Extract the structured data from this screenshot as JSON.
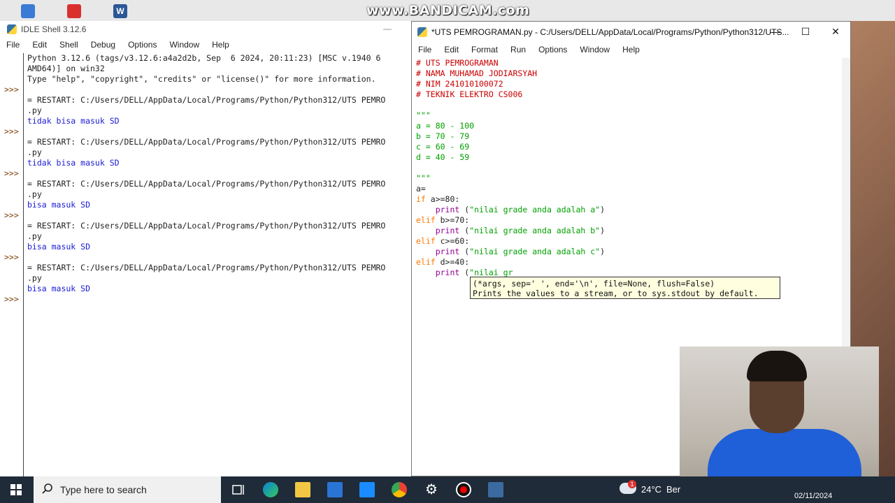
{
  "watermark": "www.BANDICAM.com",
  "shell": {
    "title": "IDLE Shell 3.12.6",
    "menu": [
      "File",
      "Edit",
      "Shell",
      "Debug",
      "Options",
      "Window",
      "Help"
    ],
    "lines": [
      {
        "t": "Python 3.12.6 (tags/v3.12.6:a4a2d2b, Sep  6 2024, 20:11:23) [MSC v.1940 6",
        "c": "out"
      },
      {
        "t": "AMD64)] on win32",
        "c": "out"
      },
      {
        "t": "Type \"help\", \"copyright\", \"credits\" or \"license()\" for more information.",
        "c": "out"
      },
      {
        "t": "",
        "c": "out"
      },
      {
        "t": "= RESTART: C:/Users/DELL/AppData/Local/Programs/Python/Python312/UTS PEMRO",
        "c": "out"
      },
      {
        "t": ".py",
        "c": "out"
      },
      {
        "t": "tidak bisa masuk SD",
        "c": "blue"
      },
      {
        "t": "",
        "c": "out"
      },
      {
        "t": "= RESTART: C:/Users/DELL/AppData/Local/Programs/Python/Python312/UTS PEMRO",
        "c": "out"
      },
      {
        "t": ".py",
        "c": "out"
      },
      {
        "t": "tidak bisa masuk SD",
        "c": "blue"
      },
      {
        "t": "",
        "c": "out"
      },
      {
        "t": "= RESTART: C:/Users/DELL/AppData/Local/Programs/Python/Python312/UTS PEMRO",
        "c": "out"
      },
      {
        "t": ".py",
        "c": "out"
      },
      {
        "t": "bisa masuk SD",
        "c": "blue"
      },
      {
        "t": "",
        "c": "out"
      },
      {
        "t": "= RESTART: C:/Users/DELL/AppData/Local/Programs/Python/Python312/UTS PEMRO",
        "c": "out"
      },
      {
        "t": ".py",
        "c": "out"
      },
      {
        "t": "bisa masuk SD",
        "c": "blue"
      },
      {
        "t": "",
        "c": "out"
      },
      {
        "t": "= RESTART: C:/Users/DELL/AppData/Local/Programs/Python/Python312/UTS PEMRO",
        "c": "out"
      },
      {
        "t": ".py",
        "c": "out"
      },
      {
        "t": "bisa masuk SD",
        "c": "blue"
      }
    ],
    "prompt": ">>>"
  },
  "editor": {
    "title": "*UTS PEMROGRAMAN.py - C:/Users/DELL/AppData/Local/Programs/Python/Python312/UTS...",
    "menu": [
      "File",
      "Edit",
      "Format",
      "Run",
      "Options",
      "Window",
      "Help"
    ],
    "lines": [
      [
        {
          "t": "# UTS PEMROGRAMAN",
          "c": "com"
        }
      ],
      [
        {
          "t": "# NAMA MUHAMAD JODIARSYAH",
          "c": "com"
        }
      ],
      [
        {
          "t": "# NIM 241010100072",
          "c": "com"
        }
      ],
      [
        {
          "t": "# TEKNIK ELEKTRO CS006",
          "c": "com"
        }
      ],
      [
        {
          "t": "",
          "c": "out"
        }
      ],
      [
        {
          "t": "\"\"\"",
          "c": "str"
        }
      ],
      [
        {
          "t": "a = 80 - 100",
          "c": "str"
        }
      ],
      [
        {
          "t": "b = 70 - 79",
          "c": "str"
        }
      ],
      [
        {
          "t": "c = 60 - 69",
          "c": "str"
        }
      ],
      [
        {
          "t": "d = 40 - 59",
          "c": "str"
        }
      ],
      [
        {
          "t": "",
          "c": "out"
        }
      ],
      [
        {
          "t": "\"\"\"",
          "c": "str"
        }
      ],
      [
        {
          "t": "a=",
          "c": "out"
        }
      ],
      [
        {
          "t": "if",
          "c": "kw"
        },
        {
          "t": " a>=80:",
          "c": "out"
        }
      ],
      [
        {
          "t": "    ",
          "c": "out"
        },
        {
          "t": "print",
          "c": "fn"
        },
        {
          "t": " (",
          "c": "out"
        },
        {
          "t": "\"nilai grade anda adalah a\"",
          "c": "str"
        },
        {
          "t": ")",
          "c": "out"
        }
      ],
      [
        {
          "t": "elif",
          "c": "kw"
        },
        {
          "t": " b>=70:",
          "c": "out"
        }
      ],
      [
        {
          "t": "    ",
          "c": "out"
        },
        {
          "t": "print",
          "c": "fn"
        },
        {
          "t": " (",
          "c": "out"
        },
        {
          "t": "\"nilai grade anda adalah b\"",
          "c": "str"
        },
        {
          "t": ")",
          "c": "out"
        }
      ],
      [
        {
          "t": "elif",
          "c": "kw"
        },
        {
          "t": " c>=60:",
          "c": "out"
        }
      ],
      [
        {
          "t": "    ",
          "c": "out"
        },
        {
          "t": "print",
          "c": "fn"
        },
        {
          "t": " (",
          "c": "out"
        },
        {
          "t": "\"nilai grade anda adalah c\"",
          "c": "str"
        },
        {
          "t": ")",
          "c": "out"
        }
      ],
      [
        {
          "t": "elif",
          "c": "kw"
        },
        {
          "t": " d>=40:",
          "c": "out"
        }
      ],
      [
        {
          "t": "    ",
          "c": "out"
        },
        {
          "t": "print",
          "c": "fn"
        },
        {
          "t": " (",
          "c": "out"
        },
        {
          "t": "\"nilai gr",
          "c": "str"
        }
      ]
    ],
    "calltip": [
      "(*args, sep=' ', end='\\n', file=None, flush=False)",
      "Prints the values to a stream, or to sys.stdout by default."
    ]
  },
  "taskbar": {
    "search_placeholder": "Type here to search",
    "temperature": "24°C",
    "weather_text": "Ber",
    "date": "02/11/2024",
    "notification_count": "1"
  }
}
